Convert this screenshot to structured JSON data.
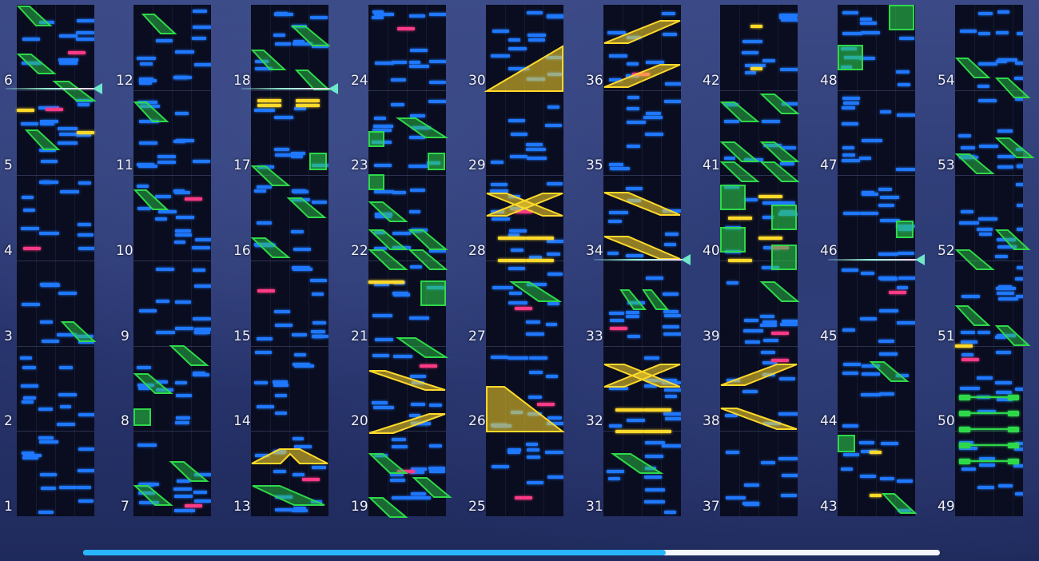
{
  "chart": {
    "columns": [
      {
        "index": 0,
        "measures": [
          "1",
          "2",
          "3",
          "4",
          "5",
          "6"
        ]
      },
      {
        "index": 1,
        "measures": [
          "7",
          "8",
          "9",
          "10",
          "11",
          "12"
        ]
      },
      {
        "index": 2,
        "measures": [
          "13",
          "14",
          "15",
          "16",
          "17",
          "18"
        ]
      },
      {
        "index": 3,
        "measures": [
          "19",
          "20",
          "21",
          "22",
          "23",
          "24"
        ]
      },
      {
        "index": 4,
        "measures": [
          "25",
          "26",
          "27",
          "28",
          "29",
          "30"
        ]
      },
      {
        "index": 5,
        "measures": [
          "31",
          "32",
          "33",
          "34",
          "35",
          "36"
        ]
      },
      {
        "index": 6,
        "measures": [
          "37",
          "38",
          "39",
          "40",
          "41",
          "42"
        ]
      },
      {
        "index": 7,
        "measures": [
          "43",
          "44",
          "45",
          "46",
          "47",
          "48"
        ]
      },
      {
        "index": 8,
        "measures": [
          "49",
          "50",
          "51",
          "52",
          "53",
          "54"
        ]
      }
    ],
    "playhead_measures": [
      "6",
      "18",
      "34",
      "46"
    ],
    "note_colors": {
      "tap": "#1f78ff",
      "flick": "#ff3a86",
      "gold": "#ffd92a",
      "slide": "#2ed84a"
    }
  },
  "scrollbar": {
    "progress": 0.68,
    "track_color": "#f4f6ff",
    "fill_color": "#28b4ff"
  }
}
